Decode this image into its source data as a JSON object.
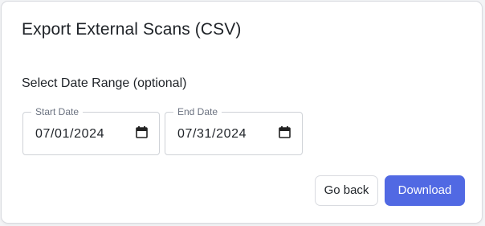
{
  "dialog": {
    "title": "Export External Scans (CSV)",
    "section_label": "Select Date Range (optional)"
  },
  "start_date": {
    "label": "Start Date",
    "value": "07/01/2024",
    "icon": "calendar-icon"
  },
  "end_date": {
    "label": "End Date",
    "value": "07/31/2024",
    "icon": "calendar-icon"
  },
  "actions": {
    "back_label": "Go back",
    "download_label": "Download"
  },
  "colors": {
    "primary": "#5169e3",
    "border": "#d9dbe0",
    "text": "#1f2328",
    "muted": "#6b7280"
  }
}
